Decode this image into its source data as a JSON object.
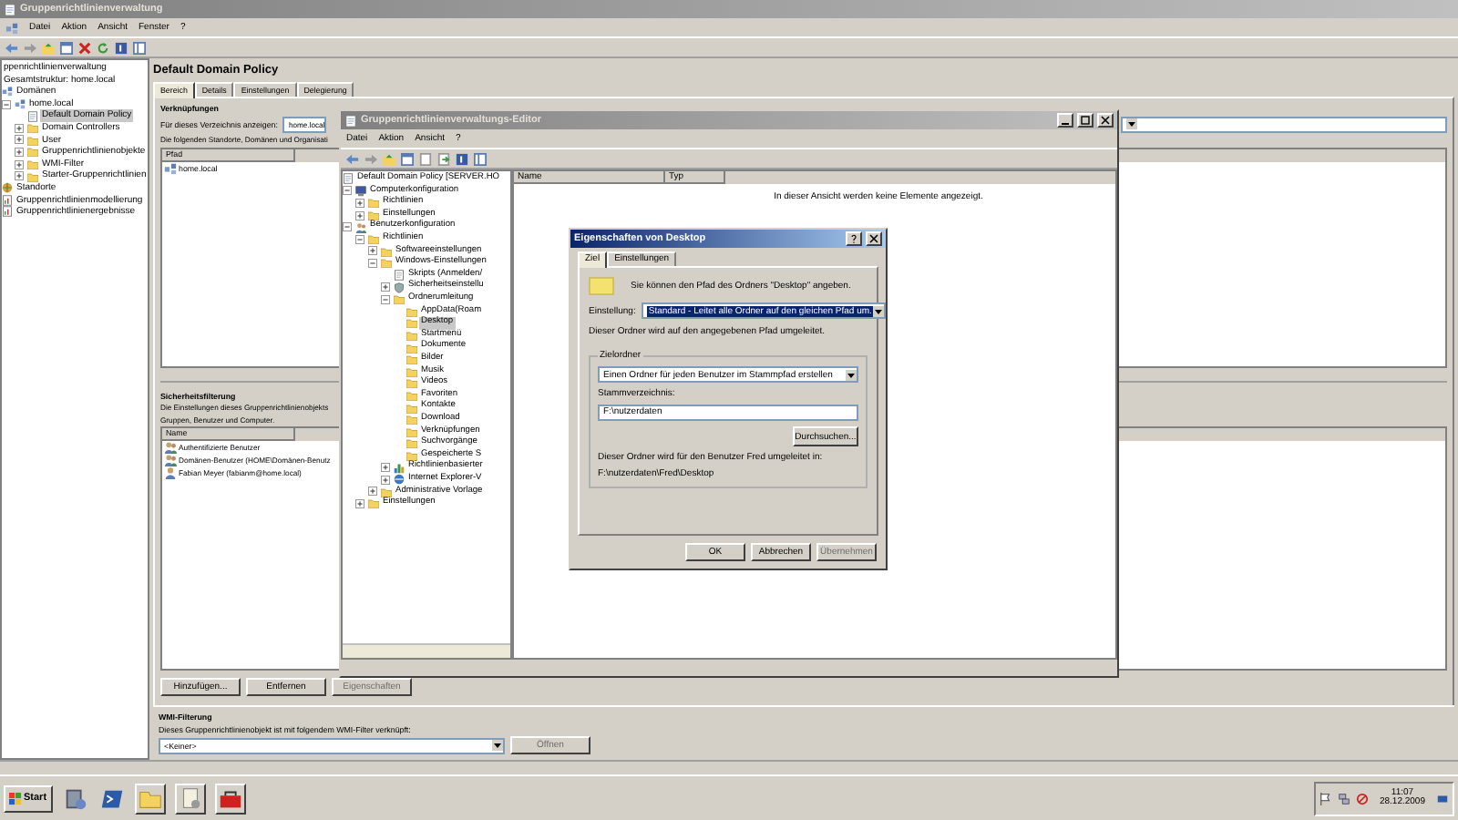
{
  "main_window": {
    "title": "Gruppenrichtlinienverwaltung",
    "menu": [
      "Datei",
      "Aktion",
      "Ansicht",
      "Fenster",
      "?"
    ],
    "tree": [
      {
        "label": "ppenrichtlinienverwaltung",
        "selected": false,
        "children": [
          {
            "label": "Gesamtstruktur: home.local",
            "selected": false,
            "children": [
              {
                "label": "Domänen",
                "kind": "domain",
                "selected": false,
                "children": [
                  {
                    "label": "home.local",
                    "kind": "domain",
                    "expanded": true,
                    "selected": false,
                    "children": [
                      {
                        "label": "Default Domain Policy",
                        "kind": "policy",
                        "selected": true
                      },
                      {
                        "label": "Domain Controllers",
                        "kind": "folder",
                        "expanded": false,
                        "selected": false
                      },
                      {
                        "label": "User",
                        "kind": "folder",
                        "expanded": false,
                        "selected": false
                      },
                      {
                        "label": "Gruppenrichtlinienobjekte",
                        "kind": "folder",
                        "expanded": false,
                        "selected": false
                      },
                      {
                        "label": "WMI-Filter",
                        "kind": "folder",
                        "expanded": false,
                        "selected": false
                      },
                      {
                        "label": "Starter-Gruppenrichtlinien",
                        "kind": "folder",
                        "expanded": false,
                        "selected": false
                      }
                    ]
                  }
                ]
              },
              {
                "label": "Standorte",
                "kind": "site",
                "selected": false
              },
              {
                "label": "Gruppenrichtlinienmodellierung",
                "kind": "report",
                "selected": false
              },
              {
                "label": "Gruppenrichtlinienergebnisse",
                "kind": "report",
                "selected": false
              }
            ]
          }
        ]
      }
    ],
    "header": "Default Domain Policy",
    "tabs": [
      {
        "label": "Bereich",
        "selected": true
      },
      {
        "label": "Details",
        "selected": false
      },
      {
        "label": "Einstellungen",
        "selected": false
      },
      {
        "label": "Delegierung",
        "selected": false
      }
    ],
    "links": {
      "heading": "Verknüpfungen",
      "scope_label": "Für dieses Verzeichnis anzeigen:",
      "scope_value": "home.local",
      "description": "Die folgenden Standorte, Domänen und Organisati",
      "columns": [
        "Pfad"
      ],
      "rows": [
        {
          "label": "home.local",
          "kind": "domain"
        }
      ]
    },
    "security": {
      "heading": "Sicherheitsfilterung",
      "description": [
        "Die Einstellungen dieses Gruppenrichtlinienobjekts",
        "Gruppen, Benutzer und Computer."
      ],
      "columns": [
        "Name"
      ],
      "rows": [
        {
          "label": "Authentifizierte Benutzer",
          "kind": "users"
        },
        {
          "label": "Domänen-Benutzer (HOME\\Domänen-Benutz",
          "kind": "users"
        },
        {
          "label": "Fabian Meyer (fabianm@home.local)",
          "kind": "user"
        }
      ]
    },
    "buttons": [
      {
        "label": "Hinzufügen...",
        "disabled": false
      },
      {
        "label": "Entfernen",
        "disabled": false
      },
      {
        "label": "Eigenschaften",
        "disabled": true
      }
    ],
    "wmi": {
      "heading": "WMI-Filterung",
      "description": "Dieses Gruppenrichtlinienobjekt ist mit folgendem WMI-Filter verknüpft:",
      "value": "<Keiner>",
      "button": {
        "label": "Öffnen",
        "disabled": true
      }
    }
  },
  "editor_window": {
    "title": "Gruppenrichtlinienverwaltungs-Editor",
    "menu": [
      "Datei",
      "Aktion",
      "Ansicht",
      "?"
    ],
    "tree": [
      {
        "label": "Default Domain Policy [SERVER.HO",
        "kind": "policy",
        "selected": false,
        "children": [
          {
            "label": "Computerkonfiguration",
            "kind": "computer",
            "expanded": true,
            "selected": false,
            "children": [
              {
                "label": "Richtlinien",
                "kind": "folder",
                "expanded": false,
                "selected": false
              },
              {
                "label": "Einstellungen",
                "kind": "folder",
                "expanded": false,
                "selected": false
              }
            ]
          },
          {
            "label": "Benutzerkonfiguration",
            "kind": "users",
            "expanded": true,
            "selected": false,
            "children": [
              {
                "label": "Richtlinien",
                "kind": "folder",
                "expanded": true,
                "selected": false,
                "children": [
                  {
                    "label": "Softwareeinstellungen",
                    "kind": "folder",
                    "expanded": false,
                    "selected": false
                  },
                  {
                    "label": "Windows-Einstellungen",
                    "kind": "folder",
                    "expanded": true,
                    "selected": false,
                    "children": [
                      {
                        "label": "Skripts (Anmelden/",
                        "kind": "script",
                        "selected": false
                      },
                      {
                        "label": "Sicherheitseinstellu",
                        "kind": "security",
                        "expanded": false,
                        "selected": false
                      },
                      {
                        "label": "Ordnerumleitung",
                        "kind": "folder",
                        "expanded": true,
                        "selected": false,
                        "children": [
                          {
                            "label": "AppData(Roam",
                            "kind": "folder",
                            "selected": false
                          },
                          {
                            "label": "Desktop",
                            "kind": "folder",
                            "selected": true
                          },
                          {
                            "label": "Startmenü",
                            "kind": "folder",
                            "selected": false
                          },
                          {
                            "label": "Dokumente",
                            "kind": "folder",
                            "selected": false
                          },
                          {
                            "label": "Bilder",
                            "kind": "folder",
                            "selected": false
                          },
                          {
                            "label": "Musik",
                            "kind": "folder",
                            "selected": false
                          },
                          {
                            "label": "Videos",
                            "kind": "folder",
                            "selected": false
                          },
                          {
                            "label": "Favoriten",
                            "kind": "folder",
                            "selected": false
                          },
                          {
                            "label": "Kontakte",
                            "kind": "folder",
                            "selected": false
                          },
                          {
                            "label": "Download",
                            "kind": "folder",
                            "selected": false
                          },
                          {
                            "label": "Verknüpfungen",
                            "kind": "folder",
                            "selected": false
                          },
                          {
                            "label": "Suchvorgänge",
                            "kind": "folder",
                            "selected": false
                          },
                          {
                            "label": "Gespeicherte S",
                            "kind": "folder",
                            "selected": false
                          }
                        ]
                      },
                      {
                        "label": "Richtlinienbasierter",
                        "kind": "chart",
                        "expanded": false,
                        "selected": false
                      },
                      {
                        "label": "Internet Explorer-V",
                        "kind": "globe",
                        "expanded": false,
                        "selected": false
                      }
                    ]
                  },
                  {
                    "label": "Administrative Vorlage",
                    "kind": "folder",
                    "expanded": false,
                    "selected": false
                  }
                ]
              },
              {
                "label": "Einstellungen",
                "kind": "folder",
                "expanded": false,
                "selected": false
              }
            ]
          }
        ]
      }
    ],
    "columns": [
      "Name",
      "Typ"
    ],
    "empty_message": "In dieser Ansicht werden keine Elemente angezeigt."
  },
  "dialog": {
    "title": "Eigenschaften von Desktop",
    "tabs": [
      {
        "label": "Ziel",
        "selected": true
      },
      {
        "label": "Einstellungen",
        "selected": false
      }
    ],
    "intro": "Sie können den Pfad des Ordners \"Desktop\" angeben.",
    "setting_label": "Einstellung:",
    "setting_value": "Standard - Leitet alle Ordner auf den gleichen Pfad um.",
    "setting_note": "Dieser Ordner wird auf den angegebenen Pfad umgeleitet.",
    "group": {
      "title": "Zielordner",
      "option": "Einen Ordner für jeden Benutzer im Stammpfad erstellen",
      "root_label": "Stammverzeichnis:",
      "root_value": "F:\\nutzerdaten",
      "browse": "Durchsuchen...",
      "result_label": "Dieser Ordner wird für den Benutzer Fred umgeleitet in:",
      "result_path": "F:\\nutzerdaten\\Fred\\Desktop"
    },
    "buttons": [
      {
        "label": "OK",
        "disabled": false
      },
      {
        "label": "Abbrechen",
        "disabled": false
      },
      {
        "label": "Übernehmen",
        "disabled": true
      }
    ]
  },
  "taskbar": {
    "start": "Start",
    "time": "11:07",
    "date": "28.12.2009"
  }
}
